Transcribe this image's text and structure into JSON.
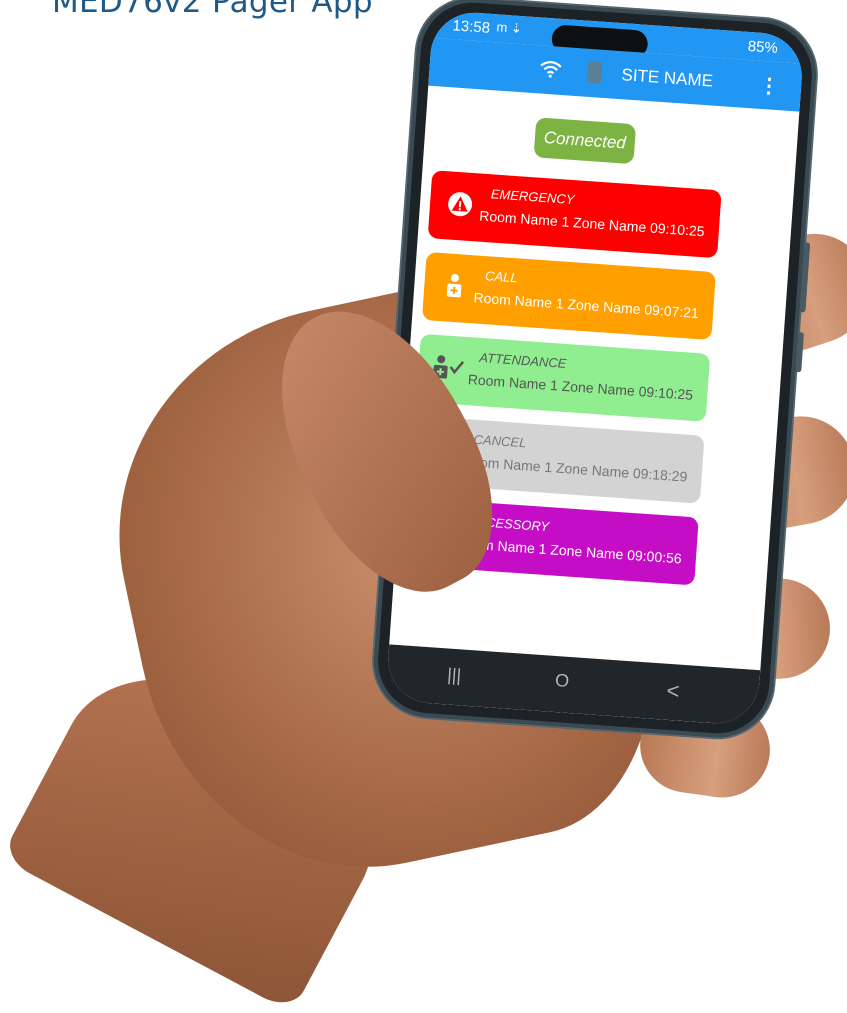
{
  "heading": "MED76v2 Pager App",
  "phone": {
    "status_time": "13:58",
    "status_icons": "m ⇣",
    "battery": "85%",
    "site_name": "SITE NAME",
    "menu_glyph": "⋮",
    "connection_status": "Connected",
    "nav": {
      "recent": "|||",
      "home": "O",
      "back": "<"
    }
  },
  "alerts": [
    {
      "type": "EMERGENCY",
      "detail": "Room Name 1 Zone Name 09:10:25",
      "color": "#ff0000",
      "text_color": "#ffffff",
      "icon": "warning-icon"
    },
    {
      "type": "CALL",
      "detail": "Room Name 1 Zone Name 09:07:21",
      "color": "#ffa000",
      "text_color": "#ffffff",
      "icon": "nurse-call-icon"
    },
    {
      "type": "ATTENDANCE",
      "detail": "Room Name 1 Zone Name 09:10:25",
      "color": "#90ee90",
      "text_color": "#555555",
      "icon": "nurse-check-icon"
    },
    {
      "type": "CANCEL",
      "detail": "Room Name 1 Zone Name 09:18:29",
      "color": "#d3d3d3",
      "text_color": "#777777",
      "icon": "refresh-icon"
    },
    {
      "type": "ACCESSORY",
      "detail": "Room Name 1 Zone Name 09:00:56",
      "color": "#c50dc5",
      "text_color": "#ffffff",
      "icon": "bed-icon"
    }
  ],
  "colors": {
    "app_bar": "#2196f3",
    "connected_badge": "#7cb342",
    "heading": "#1f5a86"
  }
}
